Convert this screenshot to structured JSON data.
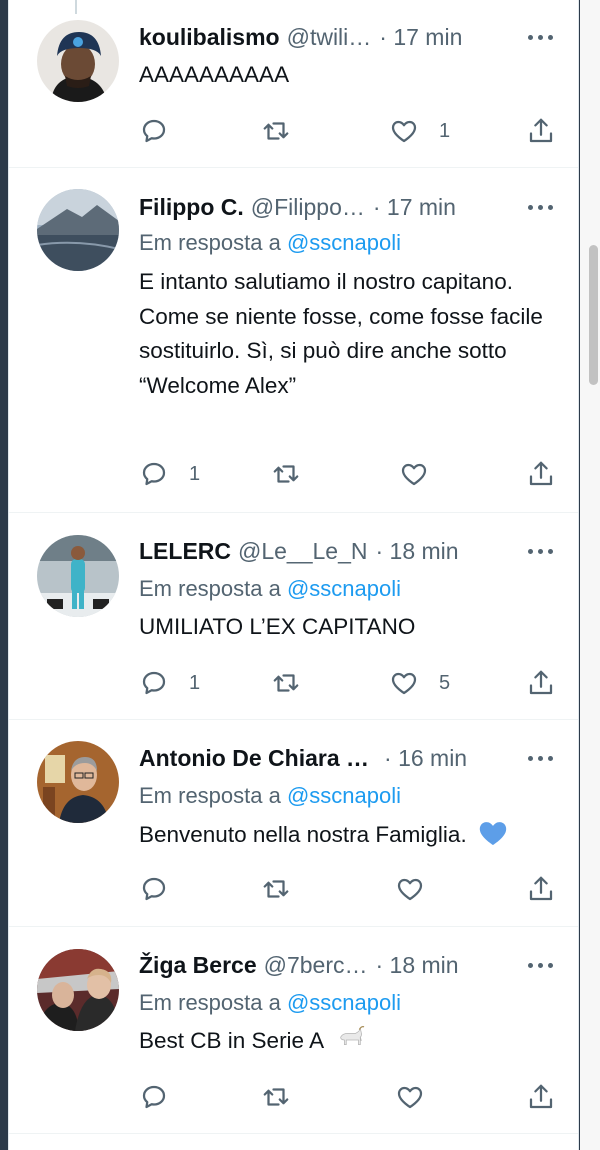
{
  "tweets": [
    {
      "name": "koulibalismo",
      "handle": "@twili…",
      "time": "· 17 min",
      "reply_label": "",
      "reply_mention": "",
      "text": "AAAAAAAAAA",
      "replies": "",
      "likes": "1"
    },
    {
      "name": "Filippo C.",
      "handle": "@Filippo…",
      "time": "· 17 min",
      "reply_label": "Em resposta a",
      "reply_mention": "@sscnapoli",
      "text": "E intanto salutiamo il nostro capitano. Come se niente fosse, come fosse facile sostituirlo. Sì, si può dire anche sotto “Welcome Alex”",
      "replies": "1",
      "likes": ""
    },
    {
      "name": "LELERC",
      "handle": "@Le__Le_N",
      "time": "· 18 min",
      "reply_label": "Em resposta a",
      "reply_mention": "@sscnapoli",
      "text": "UMILIATO L’EX CAPITANO",
      "replies": "1",
      "likes": "5"
    },
    {
      "name": "Antonio De Chiara …",
      "handle": "",
      "time": "· 16 min",
      "reply_label": "Em resposta a",
      "reply_mention": "@sscnapoli",
      "text": "Benvenuto nella nostra Famiglia.",
      "emoji": "blue-heart-emoji",
      "replies": "",
      "likes": ""
    },
    {
      "name": "Žiga Berce",
      "handle": "@7berc…",
      "time": "· 18 min",
      "reply_label": "Em resposta a",
      "reply_mention": "@sscnapoli",
      "text": "Best CB in Serie A",
      "emoji": "goat-emoji",
      "replies": "",
      "likes": ""
    }
  ],
  "colors": {
    "link": "#1d9bf0",
    "secondary_text": "#536471",
    "primary_text": "#0f1419",
    "heart_blue": "#5d9ee8"
  }
}
